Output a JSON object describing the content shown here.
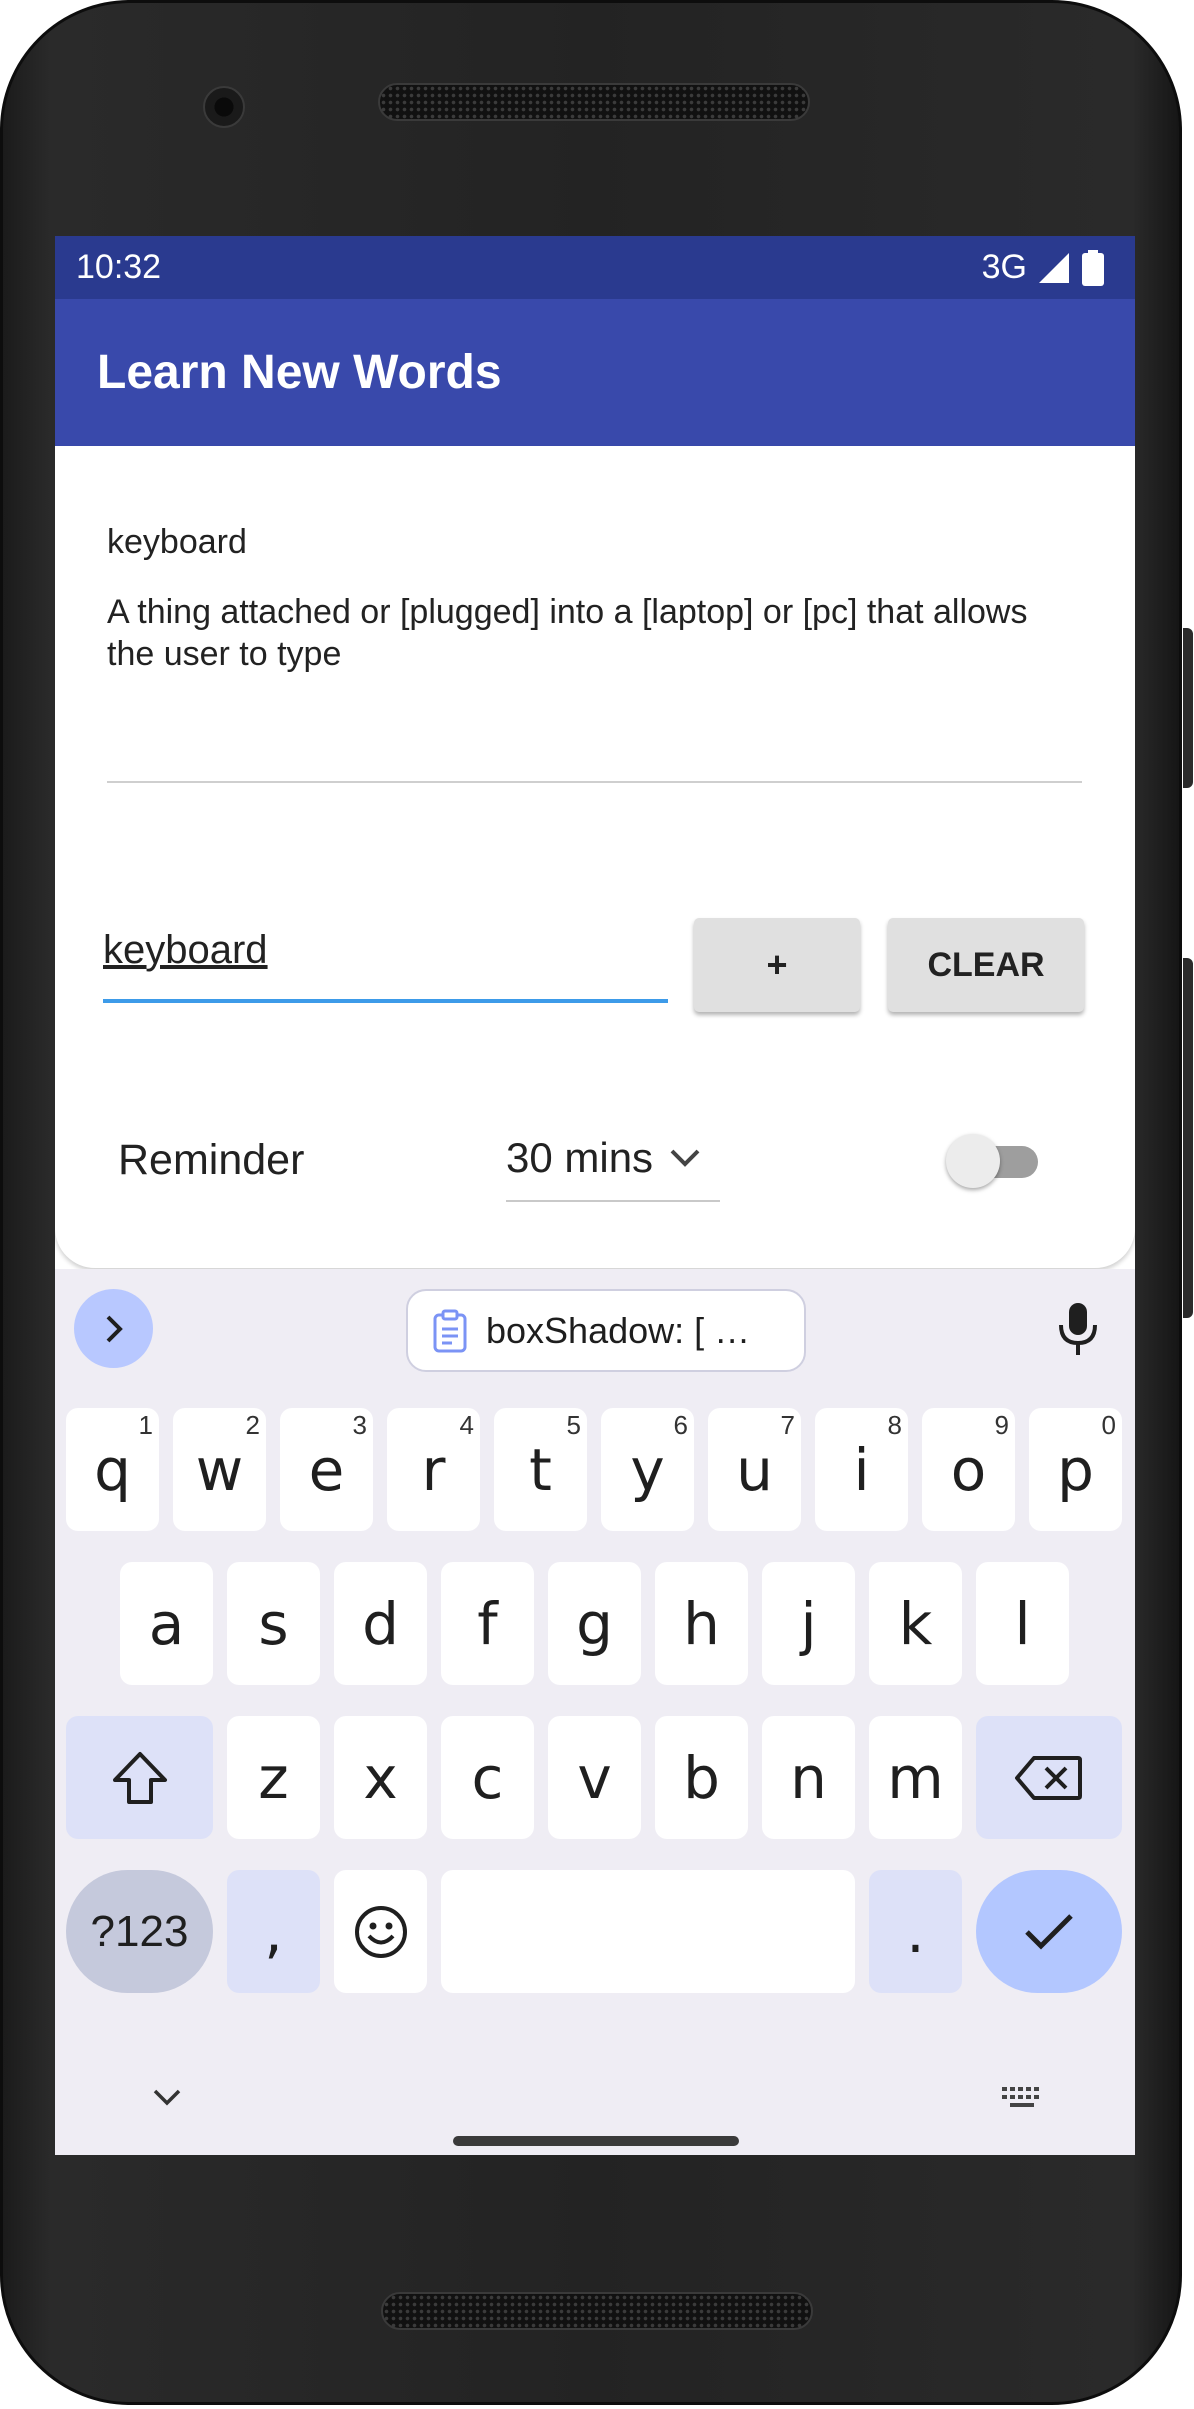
{
  "status_bar": {
    "time": "10:32",
    "network": "3G"
  },
  "app_bar": {
    "title": "Learn New Words"
  },
  "entry": {
    "word": "keyboard",
    "definition": "A thing attached or [plugged] into a [laptop] or [pc] that allows the user to type"
  },
  "word_input": {
    "value": "keyboard"
  },
  "buttons": {
    "add_label": "+",
    "clear_label": "CLEAR"
  },
  "reminder": {
    "label": "Reminder",
    "interval": "30 mins",
    "enabled": false
  },
  "keyboard": {
    "clipboard_suggestion": "boxShadow: [  …",
    "rows": [
      [
        {
          "label": "q",
          "hint": "1"
        },
        {
          "label": "w",
          "hint": "2"
        },
        {
          "label": "e",
          "hint": "3"
        },
        {
          "label": "r",
          "hint": "4"
        },
        {
          "label": "t",
          "hint": "5"
        },
        {
          "label": "y",
          "hint": "6"
        },
        {
          "label": "u",
          "hint": "7"
        },
        {
          "label": "i",
          "hint": "8"
        },
        {
          "label": "o",
          "hint": "9"
        },
        {
          "label": "p",
          "hint": "0"
        }
      ],
      [
        {
          "label": "a"
        },
        {
          "label": "s"
        },
        {
          "label": "d"
        },
        {
          "label": "f"
        },
        {
          "label": "g"
        },
        {
          "label": "h"
        },
        {
          "label": "j"
        },
        {
          "label": "k"
        },
        {
          "label": "l"
        }
      ],
      [
        {
          "label": "z"
        },
        {
          "label": "x"
        },
        {
          "label": "c"
        },
        {
          "label": "v"
        },
        {
          "label": "b"
        },
        {
          "label": "n"
        },
        {
          "label": "m"
        }
      ]
    ],
    "symbols_label": "?123",
    "comma_label": ",",
    "period_label": "."
  },
  "colors": {
    "status_bar": "#2a3a8f",
    "app_bar": "#3949ab",
    "input_focus": "#3d9be9",
    "keyboard_bg": "#efedf4",
    "key_accent": "#b3c7ff"
  },
  "icons": [
    "signal-icon",
    "battery-icon",
    "chevron-down-icon",
    "chevron-right-icon",
    "clipboard-icon",
    "mic-icon",
    "shift-icon",
    "backspace-icon",
    "emoji-icon",
    "check-icon",
    "keyboard-hide-icon",
    "keyboard-switch-icon"
  ]
}
